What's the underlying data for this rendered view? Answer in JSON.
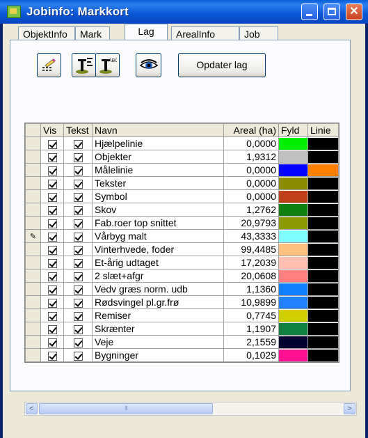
{
  "window": {
    "title": "Jobinfo: Markkort"
  },
  "tabs": [
    {
      "label": "ObjektInfo"
    },
    {
      "label": "Mark"
    },
    {
      "label": "Lag"
    },
    {
      "label": "ArealInfo"
    },
    {
      "label": "Job"
    }
  ],
  "active_tab": "Lag",
  "toolbar": {
    "update_label": "Opdater lag",
    "icons": [
      "edit-layer-icon",
      "layer-symbol-icon",
      "layer-text-icon",
      "visibility-eye-icon"
    ]
  },
  "table": {
    "headers": {
      "vis": "Vis",
      "tekst": "Tekst",
      "navn": "Navn",
      "areal": "Areal (ha)",
      "fyld": "Fyld",
      "linie": "Linie"
    },
    "rows": [
      {
        "navn": "Hjælpelinie",
        "areal": "0,0000",
        "fyld": "#00ee00",
        "linie": "#000000"
      },
      {
        "navn": "Objekter",
        "areal": "1,9312",
        "fyld": "#c0c0c0",
        "linie": "#000000"
      },
      {
        "navn": "Målelinie",
        "areal": "0,0000",
        "fyld": "#0000ff",
        "linie": "#ff8000"
      },
      {
        "navn": "Tekster",
        "areal": "0,0000",
        "fyld": "#8b8b00",
        "linie": "#000000"
      },
      {
        "navn": "Symbol",
        "areal": "0,0000",
        "fyld": "#c0401a",
        "linie": "#000000"
      },
      {
        "navn": "Skov",
        "areal": "1,2762",
        "fyld": "#108010",
        "linie": "#000000"
      },
      {
        "navn": "Fab.roer top snittet",
        "areal": "20,9793",
        "fyld": "#8a9a00",
        "linie": "#000000"
      },
      {
        "navn": "Vårbyg malt",
        "areal": "43,3333",
        "fyld": "#80ffff",
        "linie": "#000000"
      },
      {
        "navn": "Vinterhvede, foder",
        "areal": "99,4485",
        "fyld": "#ffc080",
        "linie": "#000000"
      },
      {
        "navn": "Et-årig udtaget",
        "areal": "17,2039",
        "fyld": "#ffbfb0",
        "linie": "#000000"
      },
      {
        "navn": "2 slæt+afgr",
        "areal": "20,0608",
        "fyld": "#ff8080",
        "linie": "#000000"
      },
      {
        "navn": "Vedv græs norm. udb",
        "areal": "1,1360",
        "fyld": "#1080ff",
        "linie": "#000000"
      },
      {
        "navn": "Rødsvingel pl.gr.frø",
        "areal": "10,9899",
        "fyld": "#2080ff",
        "linie": "#000000"
      },
      {
        "navn": "Remiser",
        "areal": "0,7745",
        "fyld": "#d0d000",
        "linie": "#000000"
      },
      {
        "navn": "Skrænter",
        "areal": "1,1907",
        "fyld": "#108040",
        "linie": "#000000"
      },
      {
        "navn": "Veje",
        "areal": "2,1559",
        "fyld": "#000030",
        "linie": "#000000"
      },
      {
        "navn": "Bygninger",
        "areal": "0,1029",
        "fyld": "#ff1090",
        "linie": "#000000"
      }
    ],
    "edit_row_index": 7
  },
  "scrollbar": {
    "left_arrow": "<",
    "right_arrow": ">"
  }
}
